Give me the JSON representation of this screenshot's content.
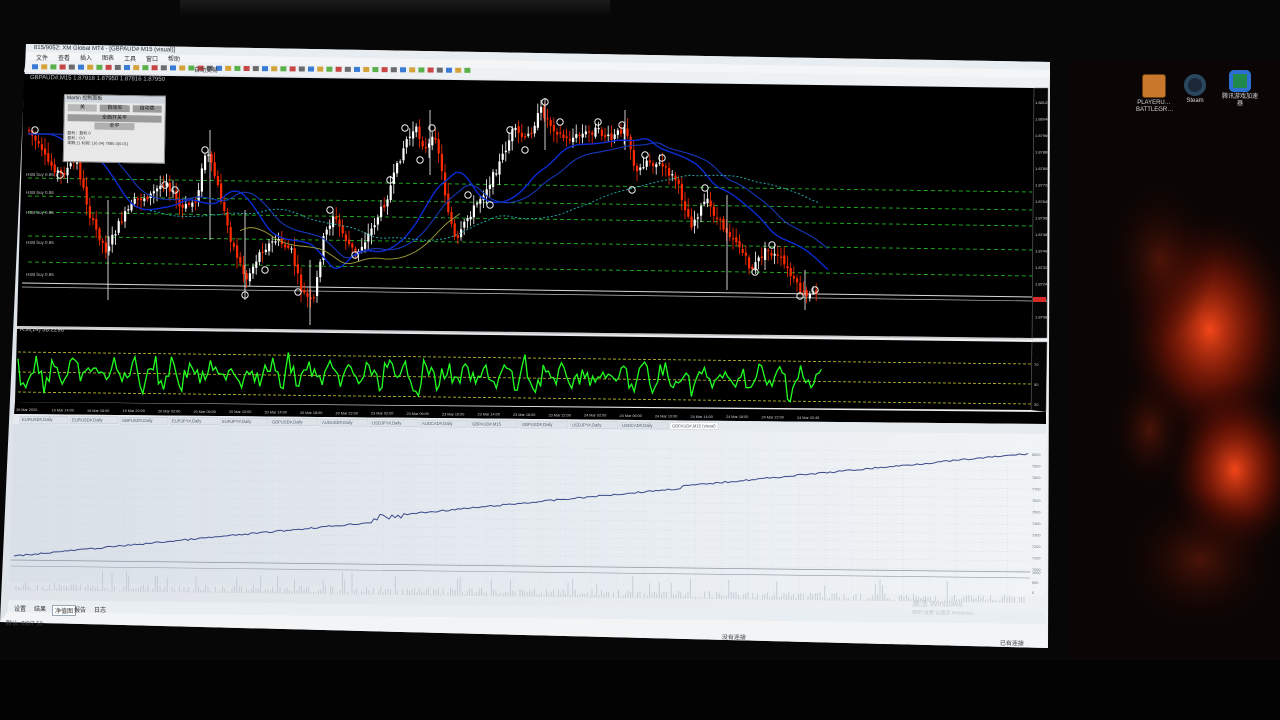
{
  "app": {
    "title": "815/9052: XM Global MT4 - [GBPAUD# M15 (visual)]",
    "menu": [
      "文件",
      "查看",
      "插入",
      "图表",
      "工具",
      "窗口",
      "帮助"
    ],
    "auto_trading_label": "自动交易",
    "window_controls": [
      "minimize",
      "maximize",
      "close"
    ]
  },
  "chart": {
    "symbol": "GBPAUD#",
    "timeframe": "M15",
    "ohlc": "GBPAUD#,M15 1.87918 1.87950 1.87816 1.87950",
    "bg_color": "#000000",
    "bull_color": "#ffffff",
    "bear_color": "#ff2a00",
    "ma_color": "#0b2bd6",
    "overlay_panel": {
      "title": "Martin 控制面板",
      "buttons": [
        "关",
        "自动买",
        "自动卖"
      ],
      "action": "全面开关平",
      "stat_label": "全平",
      "lines": [
        "盈利：盈利 0",
        "盈利：0 0",
        "本期:11 利润: (16.04) 7580.4(0.01)"
      ]
    },
    "level_labels": [
      "HSB buy 0.86",
      "HSB buy 0.86",
      "HSB buy 0.86",
      "HSB buy 0.86",
      "HSB buy 0.86"
    ],
    "price_scale": [
      "1.88120",
      "1.88040",
      "1.87960",
      "1.87880",
      "1.87800",
      "1.87720",
      "1.87640",
      "1.87560",
      "1.87480",
      "1.87400",
      "1.87320",
      "1.87240",
      "1.87160",
      "1.87080"
    ],
    "time_axis": [
      "19 Mar 2020",
      "19 Mar 14:00",
      "19 Mar 18:00",
      "19 Mar 22:00",
      "20 Mar 02:00",
      "20 Mar 06:00",
      "20 Mar 10:00",
      "20 Mar 14:00",
      "20 Mar 18:00",
      "20 Mar 22:00",
      "23 Mar 02:00",
      "23 Mar 06:00",
      "23 Mar 10:00",
      "23 Mar 14:00",
      "23 Mar 18:00",
      "23 Mar 22:00",
      "24 Mar 02:00",
      "24 Mar 06:00",
      "24 Mar 10:00",
      "24 Mar 14:00",
      "24 Mar 18:00",
      "24 Mar 22:00",
      "24 Mar 02:45"
    ]
  },
  "indicator": {
    "label": "RSI(14) 38.2298",
    "levels": [
      "70",
      "50",
      "30"
    ],
    "line_color": "#21ff21",
    "level_color": "#c8c832"
  },
  "tabs": [
    "EURUSD#,Daily",
    "EURUSD#,Daily",
    "GBPUSD#,Daily",
    "EURJPY#,Daily",
    "EURJPY#,Daily",
    "GBPUSD#,Daily",
    "AUDUSD#,Daily",
    "USDJPY#,Daily",
    "AUDCAD#,Daily",
    "GBPAUD#,M15",
    "GBPUSD#,Daily",
    "USDJPY#,Daily",
    "USDCAD#,Daily",
    "GBPAUD#,M15 (visual)"
  ],
  "tester": {
    "y_scale": [
      "8000",
      "7900",
      "7800",
      "7700",
      "7600",
      "7500",
      "7400",
      "7300",
      "7200",
      "7100",
      "7000"
    ],
    "sub_scale": [
      "1000",
      "500",
      "0"
    ],
    "line_color": "#3b4a8c",
    "bottom_tabs": [
      "设置",
      "结果",
      "净值图",
      "报告",
      "日志"
    ],
    "status_left": "默认: 2/0/7 50",
    "status_center": "没有连接",
    "status_right": "已有连接"
  },
  "watermark": {
    "line1": "激活 Windows",
    "line2": "转到\"设置\"以激活 Windows。"
  },
  "desktop": {
    "icons": [
      {
        "label": "PLAYERU… BATTLEGR…",
        "icon": "pubg-icon"
      },
      {
        "label": "Steam",
        "icon": "steam-icon"
      },
      {
        "label": "腾讯游戏加速器",
        "icon": "game-accelerator-icon"
      }
    ]
  }
}
